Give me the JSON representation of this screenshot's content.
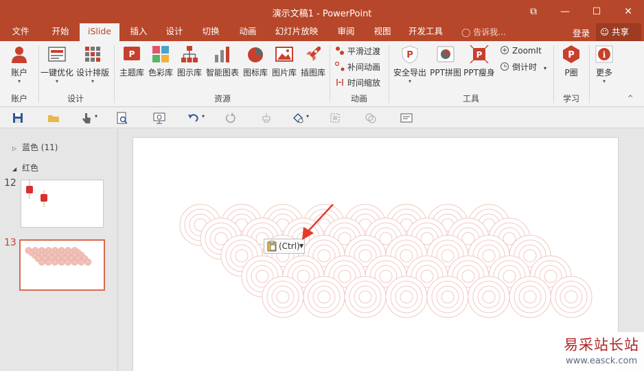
{
  "window": {
    "title": "演示文稿1 - PowerPoint",
    "controls": [
      "⧉",
      "—",
      "☐",
      "✕"
    ]
  },
  "tabs": [
    "文件",
    "开始",
    "iSlide",
    "插入",
    "设计",
    "切换",
    "动画",
    "幻灯片放映",
    "审阅",
    "视图",
    "开发工具"
  ],
  "active_tab": "iSlide",
  "tell_me": "告诉我...",
  "login": "登录",
  "share": "共享",
  "ribbon": {
    "account": {
      "label": "账户",
      "group": "账户"
    },
    "design": {
      "one_key": "一键优化",
      "layout": "设计排版",
      "group": "设计"
    },
    "resources": {
      "theme": "主题库",
      "color": "色彩库",
      "diagram": "图示库",
      "chart": "智能图表",
      "icon": "图标库",
      "picture": "图片库",
      "illustration": "插图库",
      "group": "资源"
    },
    "animation": {
      "smooth": "平滑过渡",
      "tween": "补间动画",
      "timescale": "时间缩放",
      "group": "动画"
    },
    "tools": {
      "export": "安全导出",
      "collage": "PPT拼图",
      "slim": "PPT瘦身",
      "zoomit": "ZoomIt",
      "countdown": "倒计时",
      "group": "工具"
    },
    "learn": {
      "p_circle": "P圈",
      "group": "学习"
    },
    "more": {
      "label": "更多"
    },
    "accent": "#b7472a"
  },
  "panel": {
    "sections": [
      {
        "label": "蓝色 (11)",
        "expanded": false
      },
      {
        "label": "红色",
        "expanded": true
      }
    ],
    "slides": [
      {
        "number": "12",
        "selected": false
      },
      {
        "number": "13",
        "selected": true
      }
    ]
  },
  "paste_options": {
    "label": "(Ctrl)"
  },
  "watermark": {
    "line1": "易采站长站",
    "line2": "www.easck.com"
  }
}
